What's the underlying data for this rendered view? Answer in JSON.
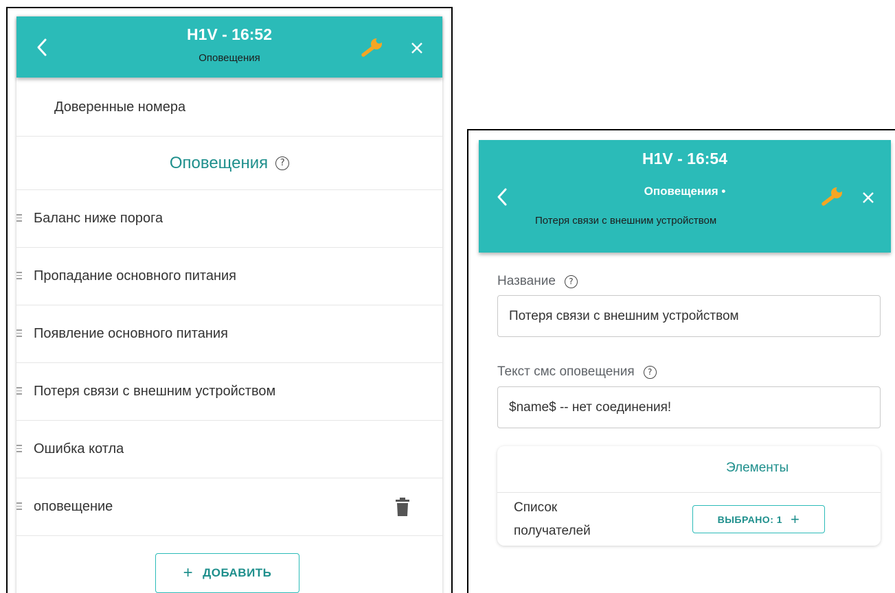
{
  "left_panel": {
    "header": {
      "title": "H1V - 16:52",
      "subtitle": "Оповещения",
      "back_icon": "chevron-left-icon",
      "settings_icon": "wrench-icon",
      "close_icon": "close-icon"
    },
    "trusted_numbers_label": "Доверенные номера",
    "section_title": "Оповещения",
    "help_glyph": "?",
    "notifications": [
      {
        "label": "Баланс ниже порога"
      },
      {
        "label": "Пропадание основного питания"
      },
      {
        "label": "Появление основного питания"
      },
      {
        "label": "Потеря связи с внешним устройством"
      },
      {
        "label": "Ошибка котла"
      },
      {
        "label": "оповещение",
        "deletable": true
      }
    ],
    "add_button_plus": "+",
    "add_button_label": "ДОБАВИТЬ"
  },
  "right_panel": {
    "header": {
      "title": "H1V - 16:54",
      "subtitle": "Оповещения •",
      "detail": "Потеря связи с внешним устройством",
      "back_icon": "chevron-left-icon",
      "settings_icon": "wrench-icon",
      "close_icon": "close-icon"
    },
    "name_label": "Название",
    "name_value": "Потеря связи с внешним устройством",
    "sms_label": "Текст смс оповещения",
    "sms_value": "$name$ -- нет соединения!",
    "help_glyph": "?",
    "elements_card": {
      "title": "Элементы",
      "recipients_label": "Список получателей",
      "selected_label": "ВЫБРАНО: 1",
      "selected_plus": "+"
    }
  },
  "colors": {
    "header_bg": "#2bbbb8",
    "accent_text": "#1e8f8c",
    "wrench": "#f5a623",
    "header_text": "#ffffff"
  }
}
